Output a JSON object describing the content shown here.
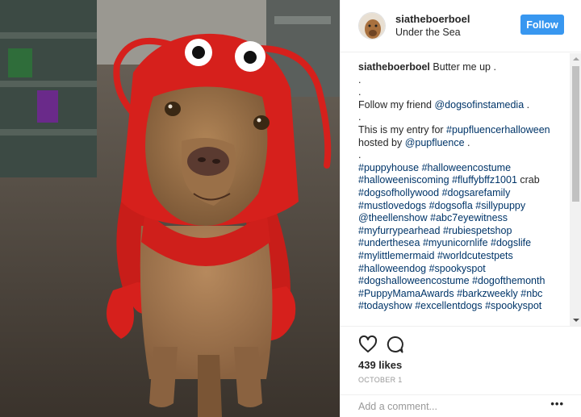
{
  "header": {
    "username": "siatheboerboel",
    "location": "Under the Sea",
    "follow_label": "Follow"
  },
  "caption": {
    "username": "siatheboerboel",
    "text": "Butter me up .",
    "dot1": ".",
    "dot2": ".",
    "follow_line_pre": "Follow my friend ",
    "follow_mention": "@dogsofinstamedia",
    "follow_line_post": " .",
    "dot3": ".",
    "entry_pre": "This is my entry for ",
    "entry_tag": "#pupfluencerhalloween",
    "hosted_pre": "hosted by ",
    "hosted_mention": "@pupfluence",
    "hosted_post": " .",
    "dot4": ".",
    "hashtag_lines": [
      [
        {
          "t": "#puppyhouse",
          "l": true
        },
        {
          "t": " ",
          "l": false
        },
        {
          "t": "#halloweencostume",
          "l": true
        }
      ],
      [
        {
          "t": "#halloweeniscoming",
          "l": true
        },
        {
          "t": " ",
          "l": false
        },
        {
          "t": "#fluffybffz1001",
          "l": true
        },
        {
          "t": " crab",
          "l": false
        }
      ],
      [
        {
          "t": "#dogsofhollywood",
          "l": true
        },
        {
          "t": " ",
          "l": false
        },
        {
          "t": "#dogsarefamily",
          "l": true
        }
      ],
      [
        {
          "t": "#mustlovedogs",
          "l": true
        },
        {
          "t": " ",
          "l": false
        },
        {
          "t": "#dogsofla",
          "l": true
        },
        {
          "t": " ",
          "l": false
        },
        {
          "t": "#sillypuppy",
          "l": true
        }
      ],
      [
        {
          "t": "@theellenshow",
          "l": true
        },
        {
          "t": " ",
          "l": false
        },
        {
          "t": "#abc7eyewitness",
          "l": true
        }
      ],
      [
        {
          "t": "#myfurrypearhead",
          "l": true
        },
        {
          "t": " ",
          "l": false
        },
        {
          "t": "#rubiespetshop",
          "l": true
        }
      ],
      [
        {
          "t": "#underthesea",
          "l": true
        },
        {
          "t": " ",
          "l": false
        },
        {
          "t": "#myunicornlife",
          "l": true
        },
        {
          "t": " ",
          "l": false
        },
        {
          "t": "#dogslife",
          "l": true
        }
      ],
      [
        {
          "t": "#mylittlemermaid",
          "l": true
        },
        {
          "t": " ",
          "l": false
        },
        {
          "t": "#worldcutestpets",
          "l": true
        }
      ],
      [
        {
          "t": "#halloweendog",
          "l": true
        },
        {
          "t": " ",
          "l": false
        },
        {
          "t": "#spookyspot",
          "l": true
        }
      ],
      [
        {
          "t": "#dogshalloweencostume",
          "l": true
        },
        {
          "t": " ",
          "l": false
        },
        {
          "t": "#dogofthemonth",
          "l": true
        }
      ],
      [
        {
          "t": "#PuppyMamaAwards",
          "l": true
        },
        {
          "t": " ",
          "l": false
        },
        {
          "t": "#barkzweekly",
          "l": true
        },
        {
          "t": " ",
          "l": false
        },
        {
          "t": "#nbc",
          "l": true
        }
      ],
      [
        {
          "t": "#todayshow",
          "l": true
        },
        {
          "t": " ",
          "l": false
        },
        {
          "t": "#excellentdogs",
          "l": true
        },
        {
          "t": " ",
          "l": false
        },
        {
          "t": "#spookyspot",
          "l": true
        }
      ]
    ]
  },
  "actions": {
    "like_icon": "heart-icon",
    "comment_icon": "speech-bubble-icon",
    "likes_text": "439 likes",
    "date_text": "OCTOBER 1"
  },
  "comment": {
    "placeholder": "Add a comment...",
    "more_label": "•••"
  },
  "colors": {
    "accent": "#3897f0",
    "link": "#003569",
    "costume_red": "#d6201c"
  }
}
